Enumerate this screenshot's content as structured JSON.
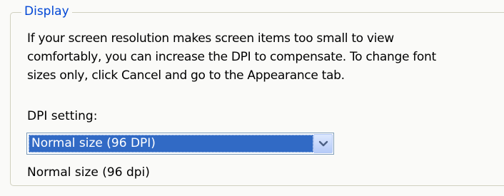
{
  "group": {
    "title": "Display"
  },
  "description": "If your screen resolution makes screen items too small to view comfortably, you can increase the DPI to compensate.  To change font sizes only, click Cancel and go to the Appearance tab.",
  "dpi": {
    "label": "DPI setting:",
    "selected": "Normal size (96 DPI)",
    "status": "Normal size (96 dpi)",
    "arrow_icon": "chevron-down-icon"
  },
  "colors": {
    "title": "#0046d5",
    "selection": "#316ac5",
    "border": "#d0d0bf"
  }
}
